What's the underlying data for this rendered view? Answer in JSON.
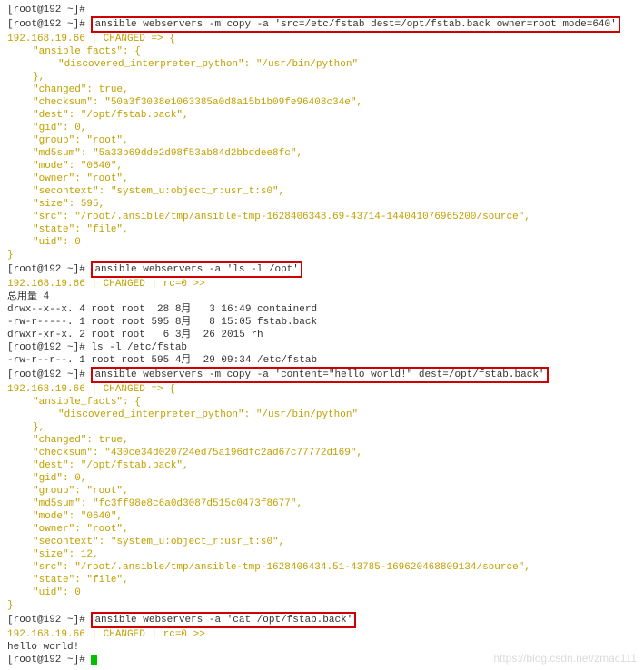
{
  "prompt": "[root@192 ~]#",
  "cmd1": "ansible webservers -m copy -a 'src=/etc/fstab dest=/opt/fstab.back owner=root mode=640'",
  "host1": "192.168.19.66 | CHANGED => {",
  "facts_open": "\"ansible_facts\": {",
  "interp": "\"discovered_interpreter_python\": \"/usr/bin/python\"",
  "close_brace": "},",
  "changed_true": "\"changed\": true,",
  "r1": {
    "checksum": "\"checksum\": \"50a3f3038e1063385a0d8a15b1b09fe96408c34e\",",
    "dest": "\"dest\": \"/opt/fstab.back\",",
    "gid": "\"gid\": 0,",
    "group": "\"group\": \"root\",",
    "md5sum": "\"md5sum\": \"5a33b69dde2d98f53ab84d2bbddee8fc\",",
    "mode": "\"mode\": \"0640\",",
    "owner": "\"owner\": \"root\",",
    "secontext": "\"secontext\": \"system_u:object_r:usr_t:s0\",",
    "size": "\"size\": 595,",
    "src": "\"src\": \"/root/.ansible/tmp/ansible-tmp-1628406348.69-43714-144041076965200/source\",",
    "state": "\"state\": \"file\",",
    "uid": "\"uid\": 0"
  },
  "close_curly": "}",
  "cmd2": "ansible webservers -a 'ls -l /opt'",
  "host2": "192.168.19.66 | CHANGED | rc=0 >>",
  "total": "总用量 4",
  "ls1": "drwx--x--x. 4 root root  28 8月   3 16:49 containerd",
  "ls2": "-rw-r-----. 1 root root 595 8月   8 15:05 fstab.back",
  "ls3": "drwxr-xr-x. 2 root root   6 3月  26 2015 rh",
  "cmd3_pre": "[root@192 ~]# ls -l /etc/fstab",
  "ls_fstab": "-rw-r--r--. 1 root root 595 4月  29 09:34 /etc/fstab",
  "cmd4": "ansible webservers -m copy -a 'content=\"hello world!\" dest=/opt/fstab.back'",
  "host3": "192.168.19.66 | CHANGED => {",
  "r2": {
    "checksum": "\"checksum\": \"430ce34d020724ed75a196dfc2ad67c77772d169\",",
    "dest": "\"dest\": \"/opt/fstab.back\",",
    "gid": "\"gid\": 0,",
    "group": "\"group\": \"root\",",
    "md5sum": "\"md5sum\": \"fc3ff98e8c6a0d3087d515c0473f8677\",",
    "mode": "\"mode\": \"0640\",",
    "owner": "\"owner\": \"root\",",
    "secontext": "\"secontext\": \"system_u:object_r:usr_t:s0\",",
    "size": "\"size\": 12,",
    "src": "\"src\": \"/root/.ansible/tmp/ansible-tmp-1628406434.51-43785-169620468809134/source\",",
    "state": "\"state\": \"file\",",
    "uid": "\"uid\": 0"
  },
  "cmd5": "ansible webservers -a 'cat /opt/fstab.back'",
  "host4": "192.168.19.66 | CHANGED | rc=0 >>",
  "hello": "hello world!",
  "watermark": "https://blog.csdn.net/zmac111"
}
